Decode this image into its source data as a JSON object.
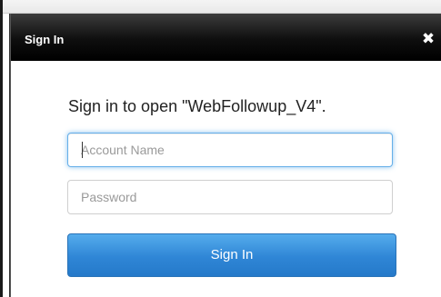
{
  "dialog": {
    "title": "Sign In",
    "close_icon": "close-icon",
    "message": "Sign in to open \"WebFollowup_V4\".",
    "account_field": {
      "placeholder": "Account Name",
      "value": ""
    },
    "password_field": {
      "placeholder": "Password",
      "value": ""
    },
    "submit_label": "Sign In"
  },
  "colors": {
    "titlebar": "#000000",
    "button": "#2f86d6",
    "focus_ring": "#66afe9"
  }
}
